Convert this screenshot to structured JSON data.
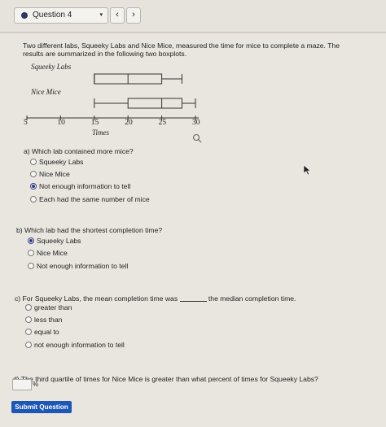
{
  "nav": {
    "question_label": "Question 4",
    "caret": "▾",
    "prev": "‹",
    "next": "›"
  },
  "question": {
    "intro": "Two different labs, Squeeky Labs and Nice Mice, measured the time for mice to complete a maze. The results are summarized in the following two boxplots."
  },
  "chart_data": {
    "type": "boxplot",
    "xlabel": "Times",
    "xlim": [
      5,
      30
    ],
    "ticks": [
      "5",
      "10",
      "15",
      "20",
      "25",
      "30"
    ],
    "tick_values": [
      5,
      10,
      15,
      20,
      25,
      30
    ],
    "series": [
      {
        "name": "Squeeky Labs",
        "min": 15,
        "q1": 15,
        "median": 20,
        "q3": 25,
        "max": 28
      },
      {
        "name": "Nice Mice",
        "min": 15,
        "q1": 20,
        "median": 25,
        "q3": 28,
        "max": 30
      }
    ]
  },
  "parts": {
    "a": {
      "question": "a) Which lab contained more mice?",
      "options": [
        "Squeeky Labs",
        "Nice Mice",
        "Not enough information to tell",
        "Each had the same number of mice"
      ],
      "selected": 2
    },
    "b": {
      "question": "b) Which lab had the shortest completion time?",
      "options": [
        "Squeeky Labs",
        "Nice Mice",
        "Not enough information to tell"
      ],
      "selected": 0
    },
    "c": {
      "question_before": "c) For Squeeky Labs, the mean completion time was",
      "question_after": "the median completion time.",
      "options": [
        "greater than",
        "less than",
        "equal to",
        "not enough information to tell"
      ],
      "selected": -1
    },
    "d": {
      "question": "d) The third quartile of times for Nice Mice is greater than what percent of times for Squeeky Labs?",
      "answer_value": "",
      "unit": "%"
    }
  },
  "submit_label": "Submit Question",
  "colors": {
    "accent": "#1c57b8",
    "radio_selected": "#2f3d86"
  }
}
